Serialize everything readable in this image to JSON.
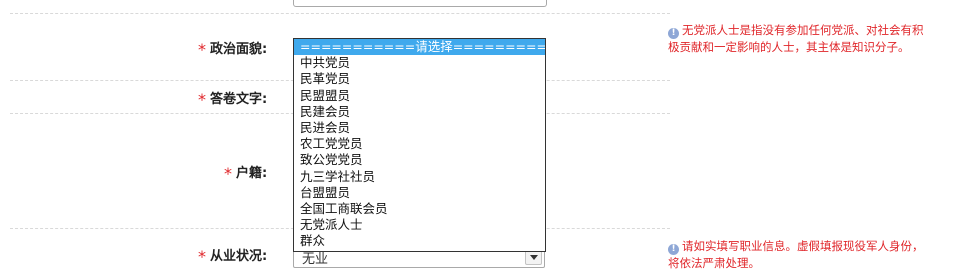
{
  "form": {
    "political_status": {
      "label": "政治面貌:",
      "required_mark": "*",
      "options": [
        "===========请选择===========",
        "中共党员",
        "民革党员",
        "民盟盟员",
        "民建会员",
        "民进会员",
        "农工党党员",
        "致公党党员",
        "九三学社社员",
        "台盟盟员",
        "全国工商联会员",
        "无党派人士",
        "群众"
      ],
      "selected_index": 0,
      "hint": "无党派人士是指没有参加任何党派、对社会有积极贡献和一定影响的人士，其主体是知识分子。"
    },
    "answer_language": {
      "label": "答卷文字:",
      "required_mark": "*"
    },
    "household": {
      "label": "户籍:",
      "required_mark": "*"
    },
    "employment": {
      "label": "从业状况:",
      "required_mark": "*",
      "value": "无业",
      "hint": "请如实填写职业信息。虚假填报现役军人身份，将依法严肃处理。"
    }
  },
  "colors": {
    "required": "#e0262a",
    "hint": "#e0262a",
    "highlight": "#3fa9ed"
  },
  "icons": {
    "hint_icon": "info-icon"
  }
}
